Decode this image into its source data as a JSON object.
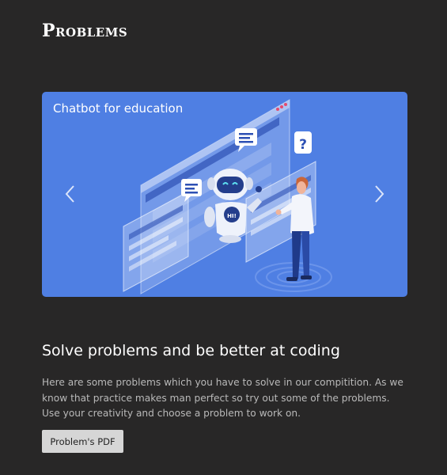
{
  "page": {
    "title": "Problems"
  },
  "carousel": {
    "slide_caption": "Chatbot for education",
    "robot_badge": "HI!",
    "icons": {
      "prev": "chevron-left-icon",
      "next": "chevron-right-icon",
      "question": "question-mark-icon"
    },
    "colors": {
      "background": "#4f7fe3",
      "accent": "#2d50b4"
    }
  },
  "section": {
    "heading": "Solve problems and be better at coding",
    "description": "Here are some problems which you have to solve in our compitition. As we know that practice makes man perfect so try out some of the problems. Use your creativity and choose a problem to work on."
  },
  "actions": {
    "pdf_button_label": "Problem's PDF"
  },
  "colors": {
    "page_background": "#282727",
    "heading": "#ffffff",
    "body_text": "#b9b9b9",
    "button_background": "#d6d6d6"
  }
}
